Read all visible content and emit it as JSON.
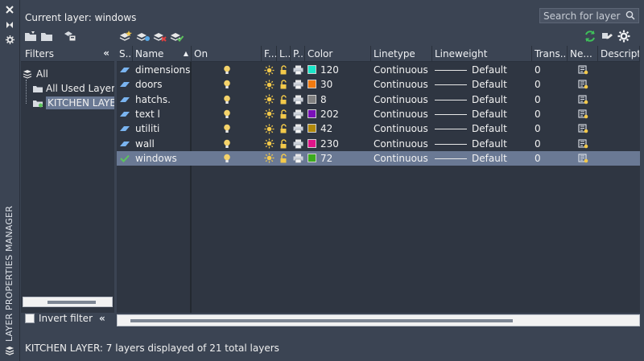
{
  "palette": {
    "panel_bg": "#3b4453",
    "grid_bg": "#2f3642",
    "selected_row": "#6a7994"
  },
  "side": {
    "vertical_title": "LAYER PROPERTIES MANAGER"
  },
  "header": {
    "current_layer": "Current layer: windows",
    "search_placeholder": "Search for layer"
  },
  "filters": {
    "title": "Filters",
    "tree": [
      {
        "label": "All"
      },
      {
        "label": "All Used Layers"
      },
      {
        "label": "KITCHEN LAYER"
      }
    ],
    "invert_label": "Invert filter"
  },
  "grid": {
    "columns": [
      "S...",
      "Name",
      "On",
      "F...",
      "L...",
      "P...",
      "Color",
      "Linetype",
      "Lineweight",
      "Trans...",
      "Ne...",
      "Descripti"
    ],
    "rows": [
      {
        "name": "dimensions",
        "color_hex": "#19e5c8",
        "color_num": "120",
        "linetype": "Continuous",
        "lineweight": "Default",
        "transparency": "0",
        "current": false
      },
      {
        "name": "doors",
        "color_hex": "#f07a10",
        "color_num": "30",
        "linetype": "Continuous",
        "lineweight": "Default",
        "transparency": "0",
        "current": false
      },
      {
        "name": "hatchs.",
        "color_hex": "#808080",
        "color_num": "8",
        "linetype": "Continuous",
        "lineweight": "Default",
        "transparency": "0",
        "current": false
      },
      {
        "name": "text l",
        "color_hex": "#7a10b8",
        "color_num": "202",
        "linetype": "Continuous",
        "lineweight": "Default",
        "transparency": "0",
        "current": false
      },
      {
        "name": "utiliti",
        "color_hex": "#b0880a",
        "color_num": "42",
        "linetype": "Continuous",
        "lineweight": "Default",
        "transparency": "0",
        "current": false
      },
      {
        "name": "wall",
        "color_hex": "#e0148a",
        "color_num": "230",
        "linetype": "Continuous",
        "lineweight": "Default",
        "transparency": "0",
        "current": false
      },
      {
        "name": "windows",
        "color_hex": "#3caa1e",
        "color_num": "72",
        "linetype": "Continuous",
        "lineweight": "Default",
        "transparency": "0",
        "current": true
      }
    ]
  },
  "status": {
    "text": "KITCHEN LAYER: 7 layers displayed of 21 total layers"
  }
}
